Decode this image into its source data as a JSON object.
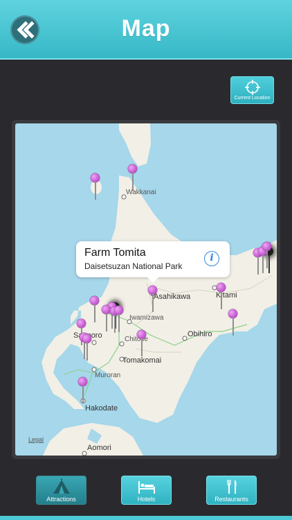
{
  "header": {
    "title": "Map",
    "back_icon": "double-chevron-left-icon"
  },
  "current_location": {
    "label": "Current Location",
    "icon": "crosshair-icon"
  },
  "map": {
    "cities": [
      {
        "name": "Wakkanai"
      },
      {
        "name": "Asahikawa"
      },
      {
        "name": "Kitami"
      },
      {
        "name": "Iwamizawa"
      },
      {
        "name": "Sapporo"
      },
      {
        "name": "Chitose"
      },
      {
        "name": "Obihiro"
      },
      {
        "name": "Tomakomai"
      },
      {
        "name": "Muroran"
      },
      {
        "name": "Hakodate"
      },
      {
        "name": "Aomori"
      }
    ],
    "legal": "Legal",
    "callout": {
      "title": "Farm Tomita",
      "subtitle": "Daisetsuzan National Park",
      "icon": "info-icon",
      "icon_glyph": "i"
    },
    "pin_color": "#c45bd0"
  },
  "tabs": [
    {
      "label": "Attractions",
      "icon": "tent-icon",
      "active": true
    },
    {
      "label": "Hotels",
      "icon": "bed-icon",
      "active": false
    },
    {
      "label": "Restaurants",
      "icon": "fork-knife-icon",
      "active": false
    }
  ],
  "colors": {
    "accent": "#37b8c6",
    "background": "#2a2a2e",
    "water": "#a6d7ea",
    "land": "#f2efe6"
  }
}
